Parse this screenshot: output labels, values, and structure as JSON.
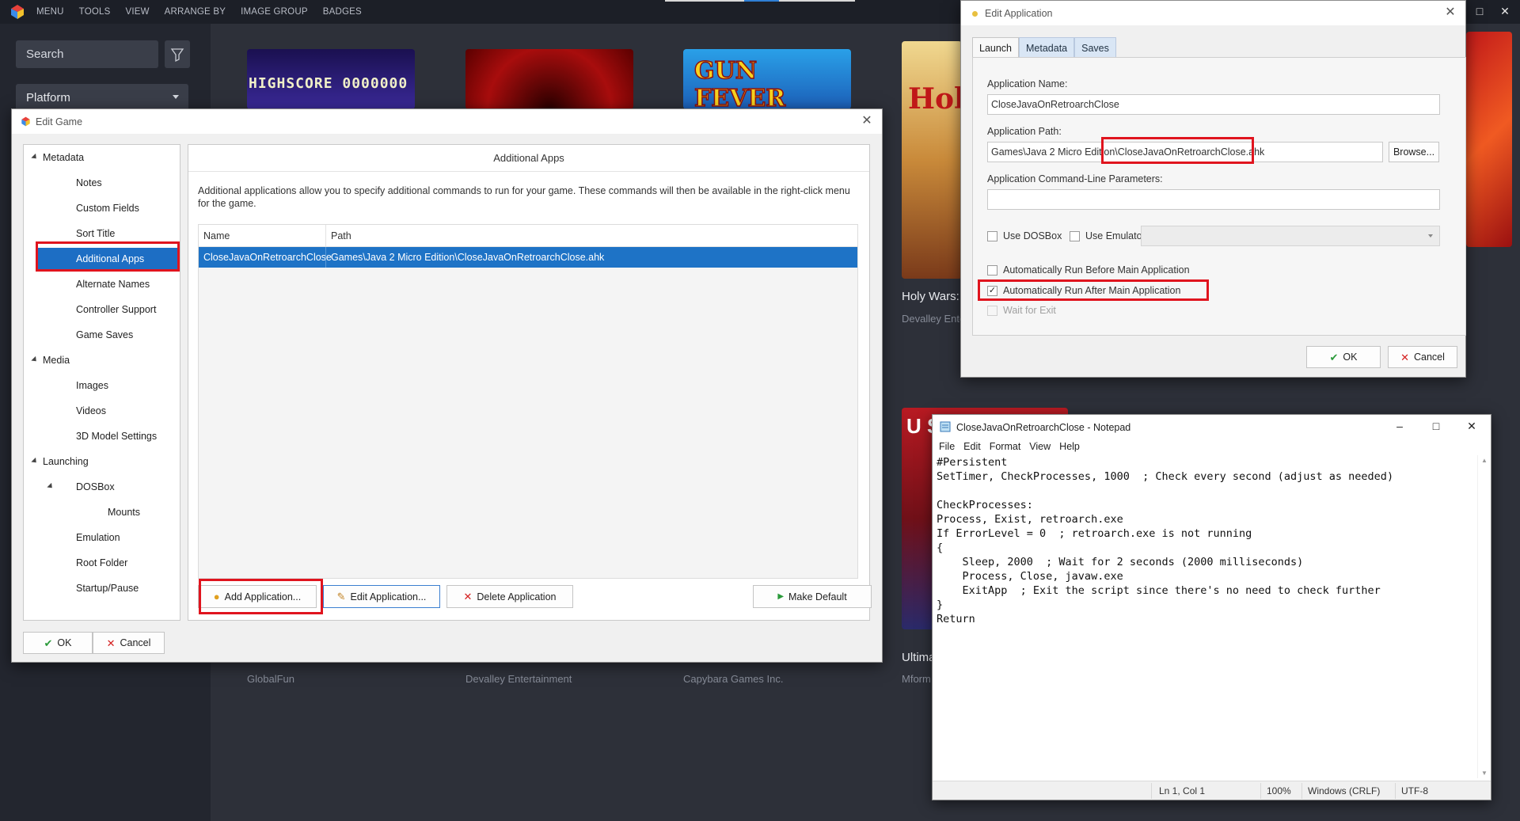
{
  "launchbox": {
    "menu": [
      "MENU",
      "TOOLS",
      "VIEW",
      "ARRANGE BY",
      "IMAGE GROUP",
      "BADGES"
    ],
    "search_placeholder": "Search",
    "platform_label": "Platform",
    "games": [
      {
        "title": "",
        "developer": "GlobalFun",
        "tile_text": "HIGHSCORE 0000000"
      },
      {
        "title": "",
        "developer": "Devalley Entertainment",
        "tile_text": ""
      },
      {
        "title": "",
        "developer": "Capybara Games Inc.",
        "tile_text": "GUN FEVER"
      },
      {
        "title": "Holy Wars: S",
        "developer": "Devalley Ente",
        "tile_text": "Hol"
      },
      {
        "title": "Ultima",
        "developer": "Mform",
        "tile_text": "U SP"
      }
    ]
  },
  "edit_game": {
    "title": "Edit Game",
    "tree": [
      {
        "label": "Metadata",
        "level": 0,
        "expander": true
      },
      {
        "label": "Notes",
        "level": 1
      },
      {
        "label": "Custom Fields",
        "level": 1
      },
      {
        "label": "Sort Title",
        "level": 1
      },
      {
        "label": "Additional Apps",
        "level": 1,
        "selected": true
      },
      {
        "label": "Alternate Names",
        "level": 1
      },
      {
        "label": "Controller Support",
        "level": 1
      },
      {
        "label": "Game Saves",
        "level": 1
      },
      {
        "label": "Media",
        "level": 0,
        "expander": true
      },
      {
        "label": "Images",
        "level": 1
      },
      {
        "label": "Videos",
        "level": 1
      },
      {
        "label": "3D Model Settings",
        "level": 1
      },
      {
        "label": "Launching",
        "level": 0,
        "expander": true
      },
      {
        "label": "DOSBox",
        "level": 1,
        "expander": true
      },
      {
        "label": "Mounts",
        "level": 2
      },
      {
        "label": "Emulation",
        "level": 1
      },
      {
        "label": "Root Folder",
        "level": 1
      },
      {
        "label": "Startup/Pause",
        "level": 1
      }
    ],
    "panel_title": "Additional Apps",
    "description": "Additional applications allow you to specify additional commands to run for your game.  These commands will then be available in the right-click menu for the game.",
    "columns": {
      "name": "Name",
      "path": "Path"
    },
    "rows": [
      {
        "name": "CloseJavaOnRetroarchClose",
        "path": "Games\\Java 2 Micro Edition\\CloseJavaOnRetroarchClose.ahk"
      }
    ],
    "buttons": {
      "add": "Add Application...",
      "edit": "Edit Application...",
      "delete": "Delete Application",
      "make_default": "Make Default",
      "ok": "OK",
      "cancel": "Cancel"
    }
  },
  "edit_app": {
    "title": "Edit Application",
    "tabs": [
      "Launch",
      "Metadata",
      "Saves"
    ],
    "app_name_label": "Application Name:",
    "app_name_value": "CloseJavaOnRetroarchClose",
    "app_path_label": "Application Path:",
    "app_path_value": "Games\\Java 2 Micro Edition\\CloseJavaOnRetroarchClose.ahk",
    "browse": "Browse...",
    "cmdline_label": "Application Command-Line Parameters:",
    "cmdline_value": "",
    "use_dosbox": "Use DOSBox",
    "use_emulator": "Use Emulator:",
    "run_before": "Automatically Run Before Main Application",
    "run_after": "Automatically Run After Main Application",
    "run_after_checked": true,
    "wait_exit": "Wait for Exit",
    "ok": "OK",
    "cancel": "Cancel"
  },
  "notepad": {
    "title": "CloseJavaOnRetroarchClose - Notepad",
    "menu": [
      "File",
      "Edit",
      "Format",
      "View",
      "Help"
    ],
    "content": "#Persistent\nSetTimer, CheckProcesses, 1000  ; Check every second (adjust as needed)\n\nCheckProcesses:\nProcess, Exist, retroarch.exe\nIf ErrorLevel = 0  ; retroarch.exe is not running\n{\n    Sleep, 2000  ; Wait for 2 seconds (2000 milliseconds)\n    Process, Close, javaw.exe\n    ExitApp  ; Exit the script since there's no need to check further\n}\nReturn",
    "status": {
      "position": "Ln 1, Col 1",
      "zoom": "100%",
      "line_endings": "Windows (CRLF)",
      "encoding": "UTF-8"
    }
  },
  "colors": {
    "selection": "#1e73c6",
    "highlight": "#e0141e",
    "lb_bg": "#2d3039"
  }
}
